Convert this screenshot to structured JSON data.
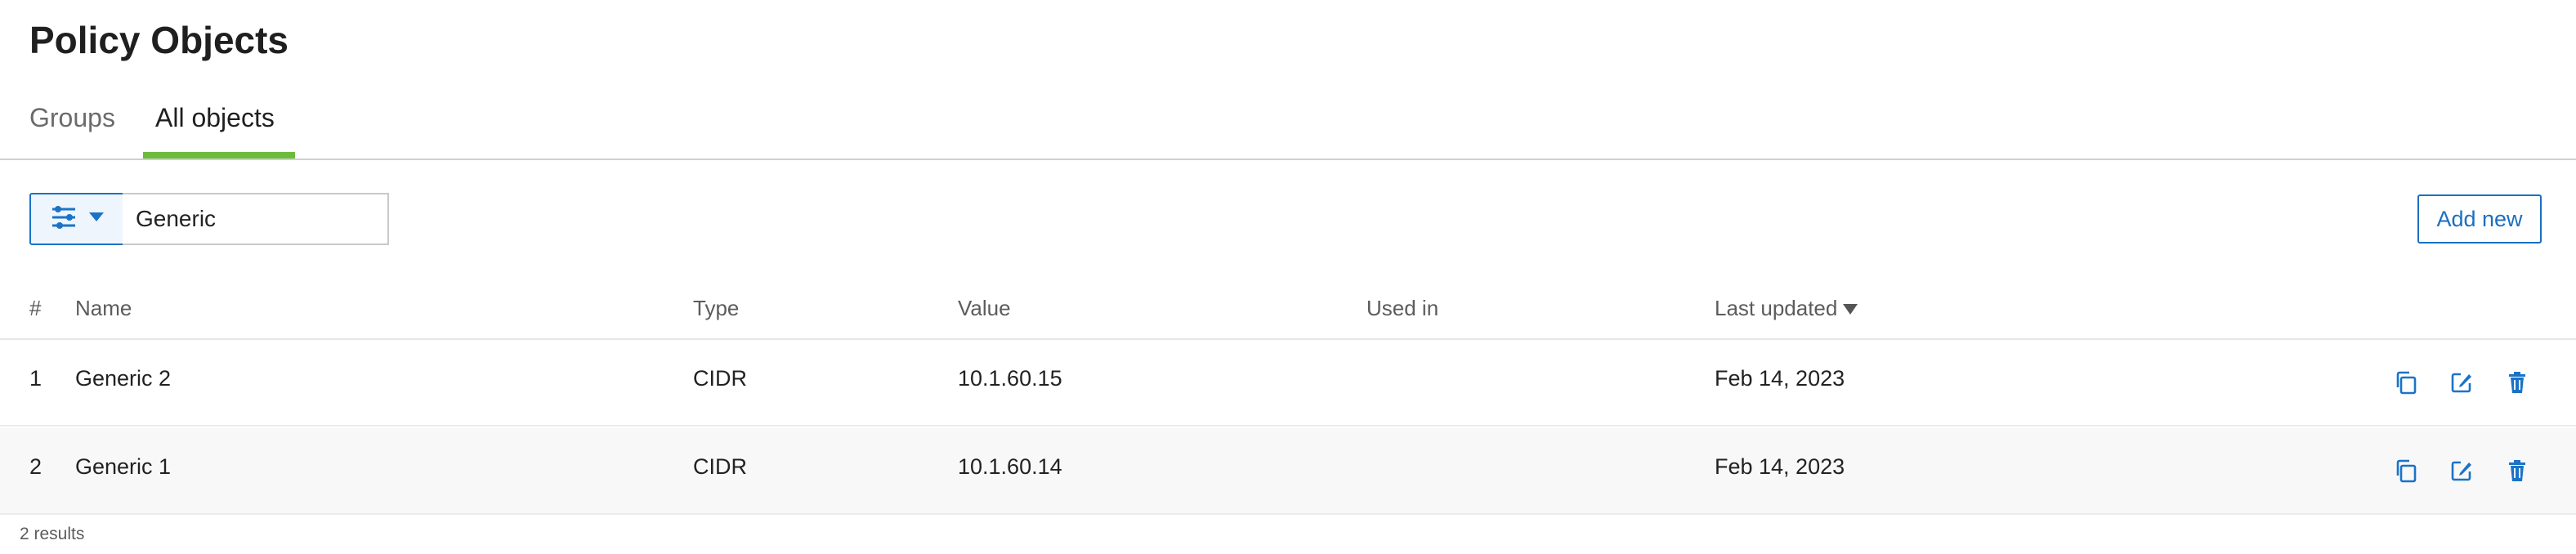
{
  "page": {
    "title": "Policy Objects"
  },
  "tabs": [
    {
      "label": "Groups",
      "active": false
    },
    {
      "label": "All objects",
      "active": true
    }
  ],
  "toolbar": {
    "filter_icon": "sliders-icon",
    "search_value": "Generic",
    "add_new_label": "Add new"
  },
  "table": {
    "columns": {
      "index": "#",
      "name": "Name",
      "type": "Type",
      "value": "Value",
      "used_in": "Used in",
      "last_updated": "Last updated"
    },
    "sort": {
      "column": "last_updated",
      "direction": "descending"
    },
    "rows": [
      {
        "index": "1",
        "name": "Generic 2",
        "type": "CIDR",
        "value": "10.1.60.15",
        "used_in": "",
        "last_updated": "Feb 14, 2023"
      },
      {
        "index": "2",
        "name": "Generic 1",
        "type": "CIDR",
        "value": "10.1.60.14",
        "used_in": "",
        "last_updated": "Feb 14, 2023"
      }
    ],
    "row_actions": [
      "copy-icon",
      "edit-icon",
      "trash-icon"
    ]
  },
  "footer": {
    "results": "2 results"
  },
  "colors": {
    "accent": "#1a73c7",
    "tab_underline": "#6cbb3c",
    "text": "#222222",
    "muted": "#6b6b6b"
  }
}
